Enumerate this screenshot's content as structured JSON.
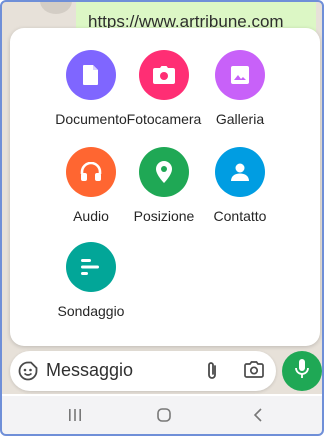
{
  "chat": {
    "bubble_text": "https://www.artribune.com"
  },
  "attach_menu": {
    "options": [
      {
        "label": "Documento",
        "icon": "document-icon",
        "color": "#7f66ff"
      },
      {
        "label": "Fotocamera",
        "icon": "camera-icon",
        "color": "#ff2e74"
      },
      {
        "label": "Galleria",
        "icon": "gallery-icon",
        "color": "#c861f9"
      },
      {
        "label": "Audio",
        "icon": "headphones-icon",
        "color": "#ff6631"
      },
      {
        "label": "Posizione",
        "icon": "location-pin-icon",
        "color": "#1fa855"
      },
      {
        "label": "Contatto",
        "icon": "contact-icon",
        "color": "#009de2"
      },
      {
        "label": "Sondaggio",
        "icon": "poll-icon",
        "color": "#02a698"
      }
    ]
  },
  "composer": {
    "placeholder": "Messaggio",
    "emoji_icon": "sticker-icon",
    "attach_icon": "paperclip-icon",
    "camera_icon": "camera-icon",
    "send_icon": "mic-icon",
    "send_color": "#1fa855"
  },
  "system_nav": {
    "recents_icon": "recents-icon",
    "home_icon": "home-icon",
    "back_icon": "back-icon"
  }
}
